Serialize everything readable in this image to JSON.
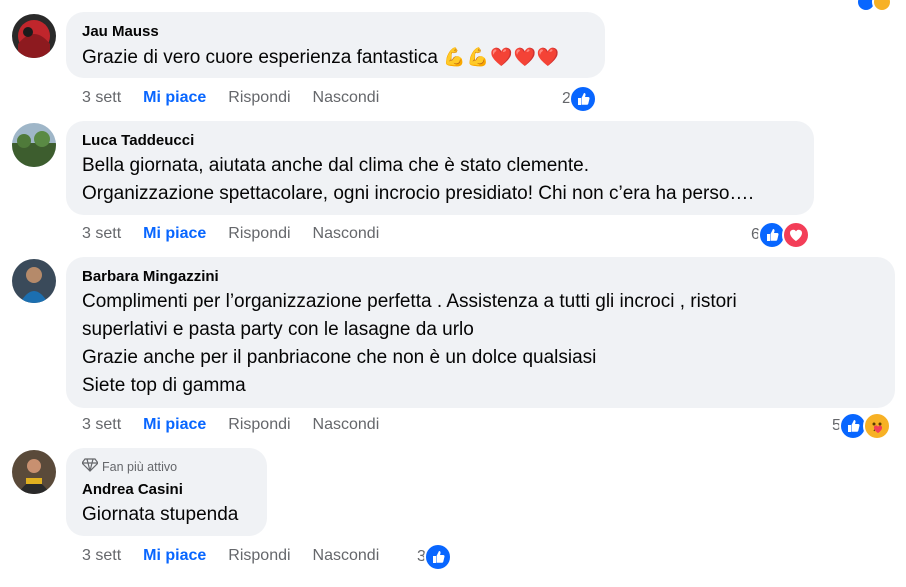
{
  "comments": [
    {
      "author": "Jau Mauss",
      "text": "Grazie di vero cuore esperienza fantastica",
      "emojis": "💪💪❤️❤️❤️",
      "time": "3 sett",
      "like": "Mi piace",
      "reply": "Rispondi",
      "hide": "Nascondi",
      "reactions": "2",
      "reaction_icons": [
        "like-icon"
      ]
    },
    {
      "author": "Luca Taddeucci",
      "text": "Bella giornata, aiutata anche dal clima che è stato clemente.\nOrganizzazione spettacolare, ogni incrocio presidiato! Chi non c’era ha perso….",
      "time": "3 sett",
      "like": "Mi piace",
      "reply": "Rispondi",
      "hide": "Nascondi",
      "reactions": "6",
      "reaction_icons": [
        "like-icon",
        "love-icon"
      ]
    },
    {
      "author": "Barbara Mingazzini",
      "text": "Complimenti per l’organizzazione perfetta . Assistenza a tutti gli incroci , ristori\nsuperlativi e pasta party con le lasagne da urlo\nGrazie anche per il panbriacone che non è un dolce qualsiasi\nSiete top di gamma",
      "time": "3 sett",
      "like": "Mi piace",
      "reply": "Rispondi",
      "hide": "Nascondi",
      "reactions": "5",
      "reaction_icons": [
        "like-icon",
        "care-icon"
      ]
    },
    {
      "badge": "Fan più attivo",
      "author": "Andrea Casini",
      "text": "Giornata stupenda",
      "time": "3 sett",
      "like": "Mi piace",
      "reply": "Rispondi",
      "hide": "Nascondi",
      "reactions": "3",
      "reaction_icons": [
        "like-icon"
      ]
    }
  ],
  "colors": {
    "like_blue": "#0866ff",
    "love_red": "#f33e58",
    "bubble": "#f0f2f5",
    "meta": "#65676b"
  }
}
